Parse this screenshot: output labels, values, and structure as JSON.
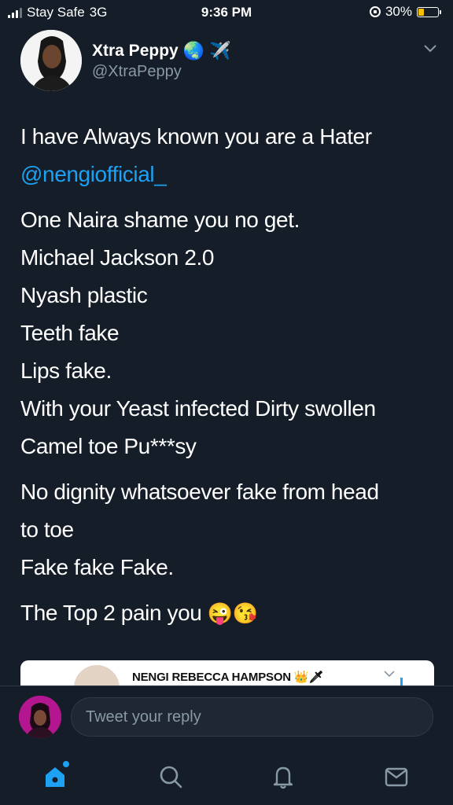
{
  "status_bar": {
    "carrier": "Stay Safe",
    "network": "3G",
    "time": "9:36 PM",
    "battery": "30%",
    "battery_level": 0.3
  },
  "tweet": {
    "author_name": "Xtra Peppy",
    "author_emojis": [
      "🌏",
      "✈️"
    ],
    "author_handle": "@XtraPeppy",
    "lines": [
      "I have Always known you are a Hater",
      "@nengiofficial_",
      "",
      "One Naira shame you no get.",
      "Michael Jackson 2.0",
      "Nyash plastic",
      "Teeth fake",
      "Lips fake.",
      "With your Yeast infected Dirty swollen",
      "Camel toe Pu***sy",
      "",
      "No dignity whatsoever fake from head",
      "to toe",
      "Fake fake Fake.",
      "",
      "The Top 2 pain you"
    ],
    "closing_emojis": "😜😘"
  },
  "quoted_tweet": {
    "author_name": "NENGI REBECCA HAMPSON",
    "author_emojis": "👑🗡"
  },
  "reply": {
    "placeholder": "Tweet your reply"
  },
  "tab_bar": {
    "tabs": [
      "home-icon",
      "search-icon",
      "notifications-icon",
      "messages-icon"
    ],
    "accent": "#1da1f2",
    "icon_color": "#8899a6"
  },
  "colors": {
    "background": "#151d28",
    "link": "#1da1f2",
    "secondary_text": "#8899a6"
  }
}
